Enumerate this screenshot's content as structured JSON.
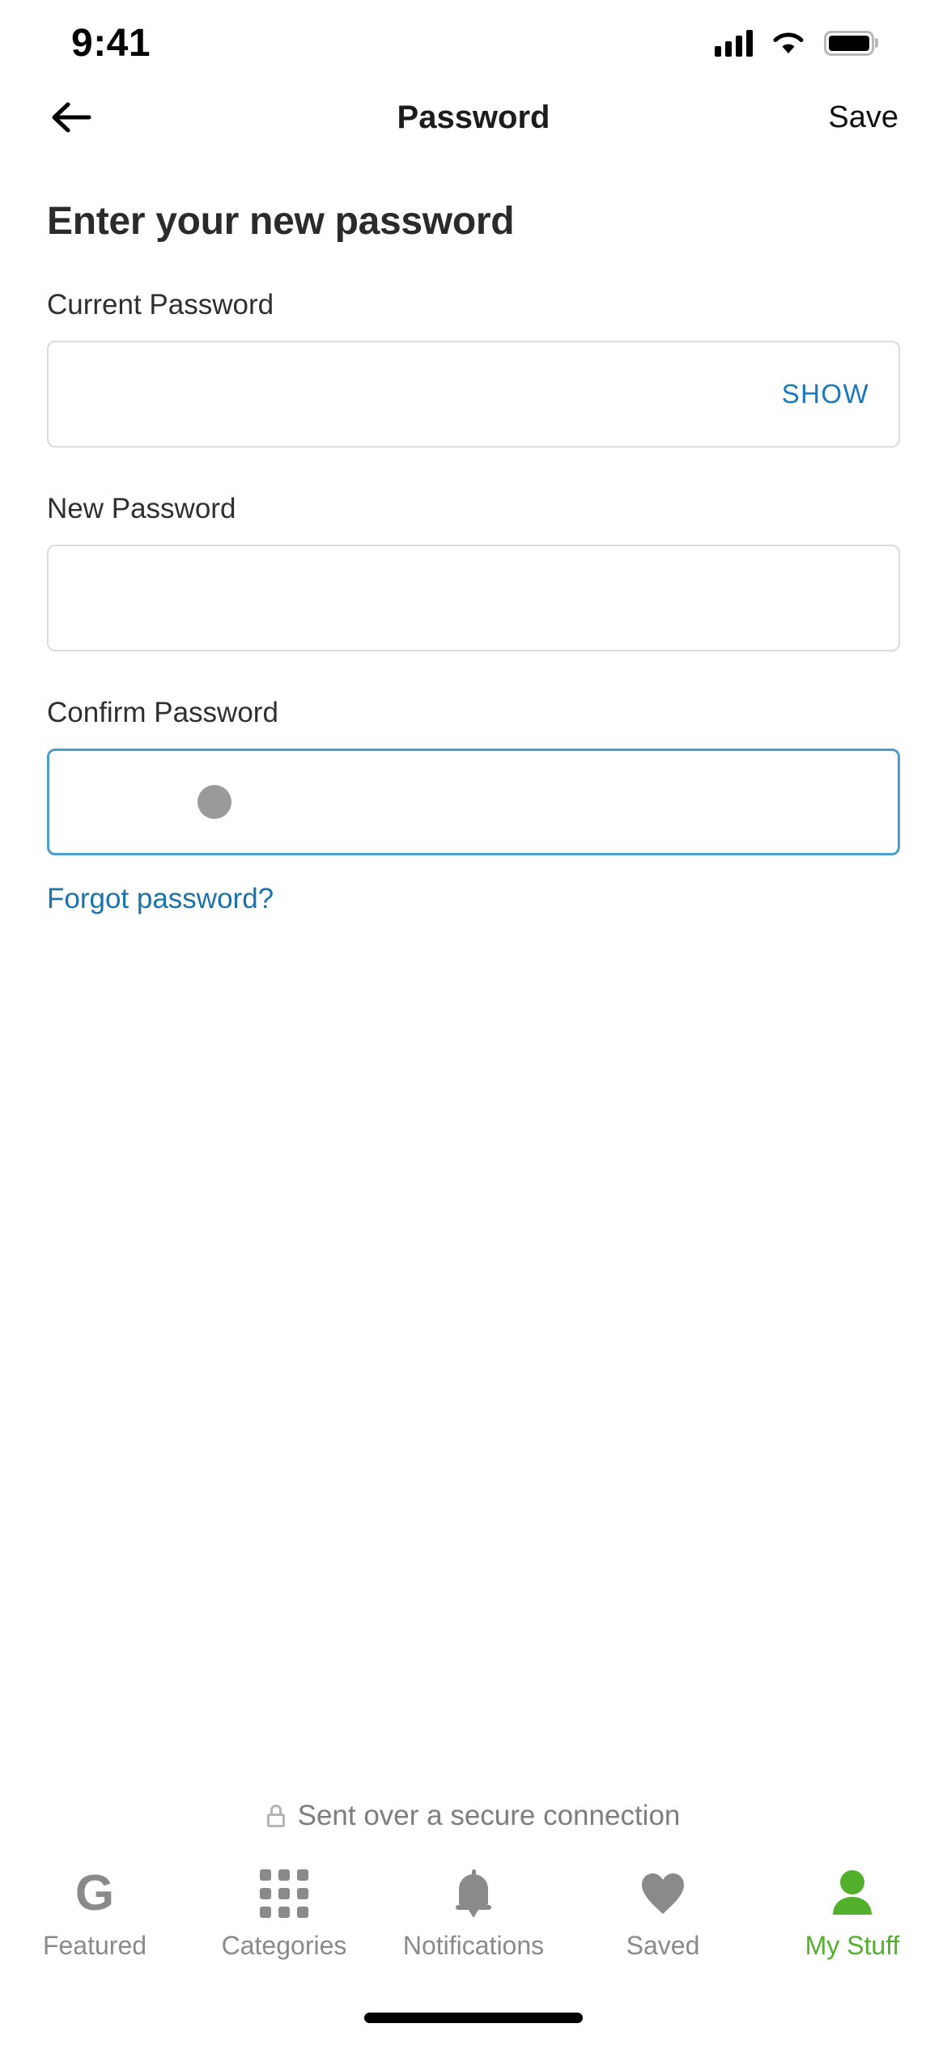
{
  "status_bar": {
    "time": "9:41",
    "cellular_icon": "cellular-signal-icon",
    "wifi_icon": "wifi-icon",
    "battery_icon": "battery-full-icon"
  },
  "nav_bar": {
    "back_icon": "back-arrow-icon",
    "title": "Password",
    "save_label": "Save"
  },
  "main": {
    "heading": "Enter your new password",
    "fields": [
      {
        "label": "Current Password",
        "value": "",
        "placeholder": "",
        "action_label": "SHOW",
        "focused": false
      },
      {
        "label": "New Password",
        "value": "",
        "placeholder": "",
        "action_label": "",
        "focused": false
      },
      {
        "label": "Confirm Password",
        "value": "",
        "placeholder": "",
        "action_label": "",
        "focused": true
      }
    ],
    "forgot_link": "Forgot password?"
  },
  "secure_note": {
    "icon": "lock-icon",
    "text": "Sent over a secure connection"
  },
  "tab_bar": {
    "items": [
      {
        "label": "Featured",
        "icon": "google-g-icon",
        "active": false
      },
      {
        "label": "Categories",
        "icon": "grid-icon",
        "active": false
      },
      {
        "label": "Notifications",
        "icon": "bell-icon",
        "active": false
      },
      {
        "label": "Saved",
        "icon": "heart-icon",
        "active": false
      },
      {
        "label": "My Stuff",
        "icon": "person-icon",
        "active": true
      }
    ]
  },
  "colors": {
    "accent_blue": "#1879be",
    "link_blue": "#1a73ad",
    "focus_border": "#4A9FD0",
    "active_green": "#52b02c",
    "border_gray": "#dcdcdc",
    "muted_text": "#8a8a8a"
  }
}
